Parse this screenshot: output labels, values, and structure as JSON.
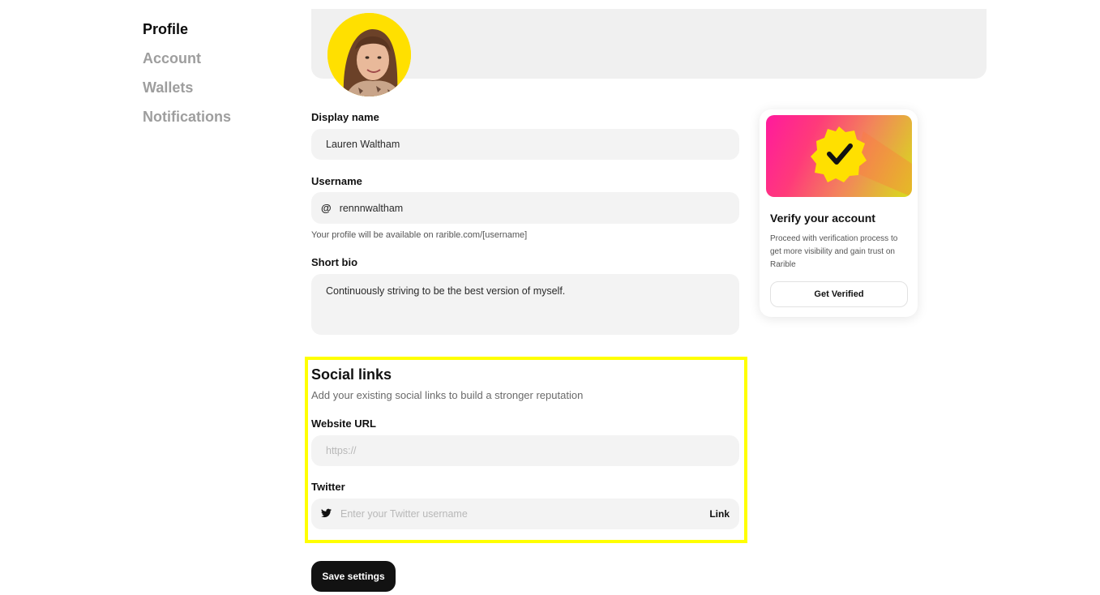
{
  "sidebar": {
    "items": [
      {
        "label": "Profile"
      },
      {
        "label": "Account"
      },
      {
        "label": "Wallets"
      },
      {
        "label": "Notifications"
      }
    ]
  },
  "form": {
    "display_name": {
      "label": "Display name",
      "value": "Lauren Waltham"
    },
    "username": {
      "label": "Username",
      "prefix": "@",
      "value": "rennnwaltham",
      "hint": "Your profile will be available on rarible.com/[username]"
    },
    "bio": {
      "label": "Short bio",
      "value": "Continuously striving to be the best version of myself."
    }
  },
  "social": {
    "title": "Social links",
    "subtitle": "Add your existing social links to build a stronger reputation",
    "website": {
      "label": "Website URL",
      "placeholder": "https://"
    },
    "twitter": {
      "label": "Twitter",
      "placeholder": "Enter your Twitter username",
      "link_label": "Link"
    }
  },
  "save_label": "Save settings",
  "verify": {
    "title": "Verify your account",
    "text": "Proceed with verification process to get more visibility and gain trust on Rarible",
    "button": "Get Verified"
  },
  "colors": {
    "highlight": "#ffff00",
    "avatar_bg": "#ffe000",
    "primary_button": "#121212"
  }
}
